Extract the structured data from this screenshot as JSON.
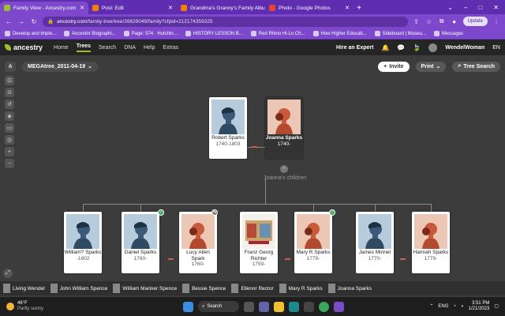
{
  "browser": {
    "tabs": [
      {
        "title": "Family View - Ancestry.com",
        "color": "#9cbe30",
        "active": true
      },
      {
        "title": "Post: Edit",
        "color": "#f57d00",
        "active": false
      },
      {
        "title": "Grandma's Granny's Family Albu",
        "color": "#f57d00",
        "active": false
      },
      {
        "title": "Photo - Google Photos",
        "color": "#ea4335",
        "active": false
      }
    ],
    "new_tab": "+",
    "url_domain": "ancestry.com",
    "url_path": "/family-tree/tree/26629049/family?cfpid=212174359325",
    "update_label": "Update",
    "bookmarks": [
      "Develop and Imple...",
      "Ancestor Biographi...",
      "Page: 574 · Hutchin...",
      "HISTORY LESSON B...",
      "Red Rhino Hi-Lo Ch...",
      "How Higher Educati...",
      "Sideboard | Museu...",
      "Messages"
    ]
  },
  "ancestry": {
    "logo": "ancestry",
    "nav": [
      "Home",
      "Trees",
      "Search",
      "DNA",
      "Help",
      "Extras"
    ],
    "active_nav": "Trees",
    "hire": "Hire an Expert",
    "user": "WendelWoman",
    "lang": "EN"
  },
  "tree": {
    "name": "MEGAtree_2011-04-19",
    "invite": "Invite",
    "print": "Print",
    "search": "Tree Search",
    "children_label": "Joanna's children"
  },
  "parents": [
    {
      "name": "Robert Sparks",
      "dates": "1740-1803",
      "gender": "male"
    },
    {
      "name": "Joanna Sparks",
      "dates": "1740-",
      "gender": "female",
      "selected": true
    }
  ],
  "children": [
    {
      "name": "William? Sparks",
      "dates": "-1802",
      "gender": "male"
    },
    {
      "name": "Daniel Sparks",
      "dates": "1760-",
      "gender": "male"
    },
    {
      "name": "Lucy Allen Spark",
      "dates": "1760-",
      "gender": "female"
    },
    {
      "name": "Franz Georg Richter",
      "dates": "1759-",
      "gender": "photo"
    },
    {
      "name": "Mary R Sparks",
      "dates": "1779-",
      "gender": "female"
    },
    {
      "name": "James Minnet",
      "dates": "1770-",
      "gender": "male"
    },
    {
      "name": "Hannah Sparks",
      "dates": "1779-",
      "gender": "female"
    }
  ],
  "recent": [
    "Living Wendel",
    "John William Spence",
    "William Mariner Spence",
    "Bessie Spence",
    "Ellenor Rector",
    "Mary R Sparks",
    "Joanna Sparks"
  ],
  "taskbar": {
    "temp": "46°F",
    "weather": "Partly sunny",
    "search": "Search",
    "lang": "ENG",
    "time": "3:51 PM",
    "date": "1/21/2023"
  },
  "colors": {
    "accent": "#9cbe30",
    "browser": "#7e48cc",
    "male": "#b6ccdd",
    "female": "#ecc7b5"
  }
}
